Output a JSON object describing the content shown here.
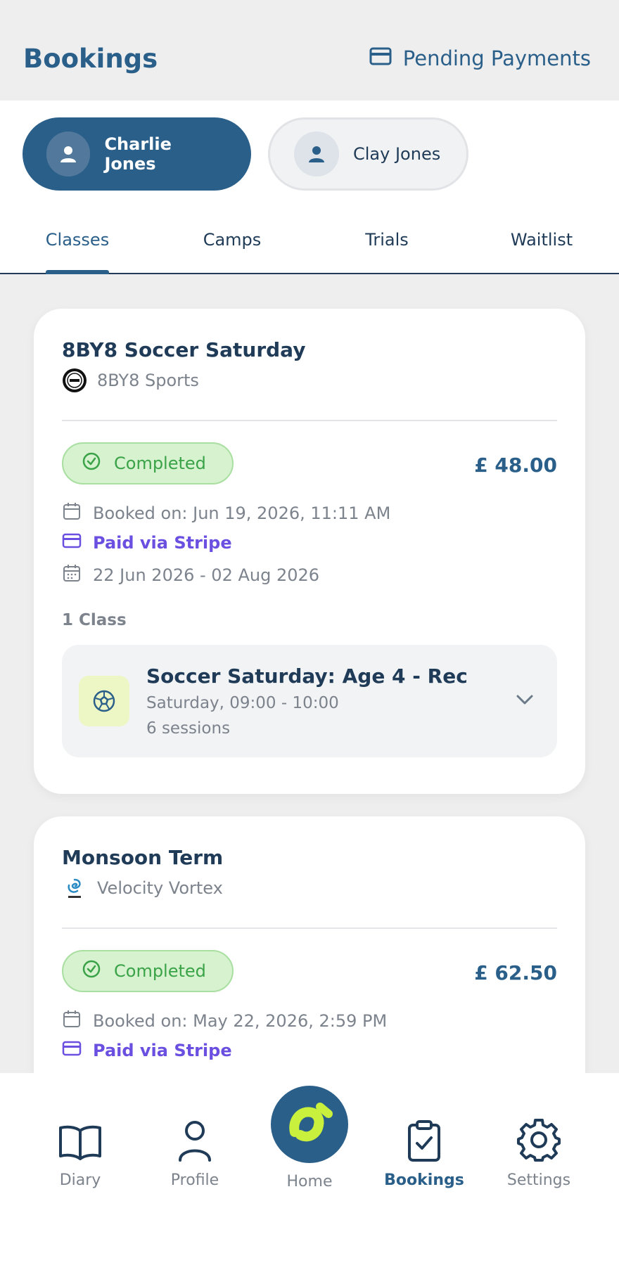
{
  "header": {
    "title": "Bookings",
    "pending_label": "Pending Payments"
  },
  "children": [
    {
      "name": "Charlie Jones",
      "selected": true
    },
    {
      "name": "Clay Jones",
      "selected": false
    }
  ],
  "tabs": [
    {
      "label": "Classes",
      "active": true
    },
    {
      "label": "Camps",
      "active": false
    },
    {
      "label": "Trials",
      "active": false
    },
    {
      "label": "Waitlist",
      "active": false
    }
  ],
  "bookings": [
    {
      "title": "8BY8 Soccer Saturday",
      "provider": "8BY8 Sports",
      "status": "Completed",
      "price": "£ 48.00",
      "booked_on": "Booked on: Jun 19, 2026, 11:11 AM",
      "payment": "Paid via Stripe",
      "date_range": "22 Jun 2026 - 02 Aug 2026",
      "class_count": "1 Class",
      "session": {
        "name": "Soccer Saturday: Age 4 - Rec",
        "time": "Saturday, 09:00 - 10:00",
        "sessions": "6 sessions"
      }
    },
    {
      "title": "Monsoon Term",
      "provider": "Velocity Vortex",
      "status": "Completed",
      "price": "£ 62.50",
      "booked_on": "Booked on: May 22, 2026, 2:59 PM",
      "payment": "Paid via Stripe"
    }
  ],
  "nav": {
    "diary": "Diary",
    "profile": "Profile",
    "home": "Home",
    "bookings": "Bookings",
    "settings": "Settings"
  },
  "colors": {
    "brand": "#2a5f8a",
    "accent": "#c8f03c",
    "success": "#3aa348",
    "payment": "#6a4fe0"
  }
}
